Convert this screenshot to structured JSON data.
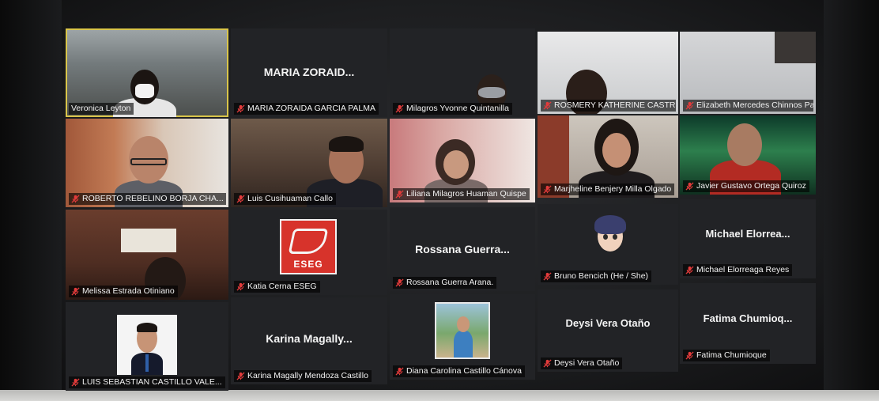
{
  "colors": {
    "active_speaker_border": "#d9c54a",
    "mic_muted": "#e23b3b",
    "tile_background": "#222326",
    "logo_red": "#d7332b"
  },
  "participants": [
    {
      "name": "Veronica Leyton",
      "display": "video",
      "muted": false,
      "active": true
    },
    {
      "name": "MARIA ZORAIDA GARCIA PALMA",
      "big_name": "MARIA ZORAID...",
      "display": "name",
      "muted": true
    },
    {
      "name": "Milagros Yvonne Quintanilla",
      "display": "video",
      "muted": true
    },
    {
      "name": "ROSMERY KATHERINE CASTRO ...",
      "display": "video",
      "muted": true
    },
    {
      "name": "Elizabeth Mercedes Chinnos Pal...",
      "display": "video",
      "muted": true
    },
    {
      "name": "ROBERTO REBELINO BORJA CHA...",
      "display": "video",
      "muted": true
    },
    {
      "name": "Luis Cusihuaman Callo",
      "display": "video",
      "muted": true
    },
    {
      "name": "Liliana Milagros Huaman Quispe",
      "display": "video",
      "muted": true
    },
    {
      "name": "Marjheline Benjery Milla Olgado",
      "display": "video",
      "muted": true
    },
    {
      "name": "Javier Gustavo Ortega Quiroz",
      "display": "video",
      "muted": true
    },
    {
      "name": "Melissa Estrada Otiniano",
      "display": "video",
      "muted": true
    },
    {
      "name": "Katia Cerna ESEG",
      "display": "logo",
      "logo_text": "ESEG",
      "muted": true
    },
    {
      "name": "Rossana Guerra Arana.",
      "big_name": "Rossana Guerra...",
      "display": "name",
      "muted": true
    },
    {
      "name": "Bruno Bencich (He / She)",
      "display": "avatar",
      "muted": true
    },
    {
      "name": "Michael Elorreaga Reyes",
      "big_name": "Michael Elorrea...",
      "display": "name",
      "muted": true
    },
    {
      "name": "LUIS SEBASTIAN CASTILLO VALE...",
      "display": "photo",
      "muted": true
    },
    {
      "name": "Karina Magally Mendoza Castillo",
      "big_name": "Karina Magally...",
      "display": "name",
      "muted": true
    },
    {
      "name": "Diana Carolina Castillo Cánova",
      "display": "photo",
      "muted": true
    },
    {
      "name": "Deysi Vera Otaño",
      "big_name": "Deysi Vera Otaño",
      "display": "name",
      "muted": true
    },
    {
      "name": "Fatima Chumioque",
      "big_name": "Fatima Chumioq...",
      "display": "name",
      "muted": true
    }
  ]
}
